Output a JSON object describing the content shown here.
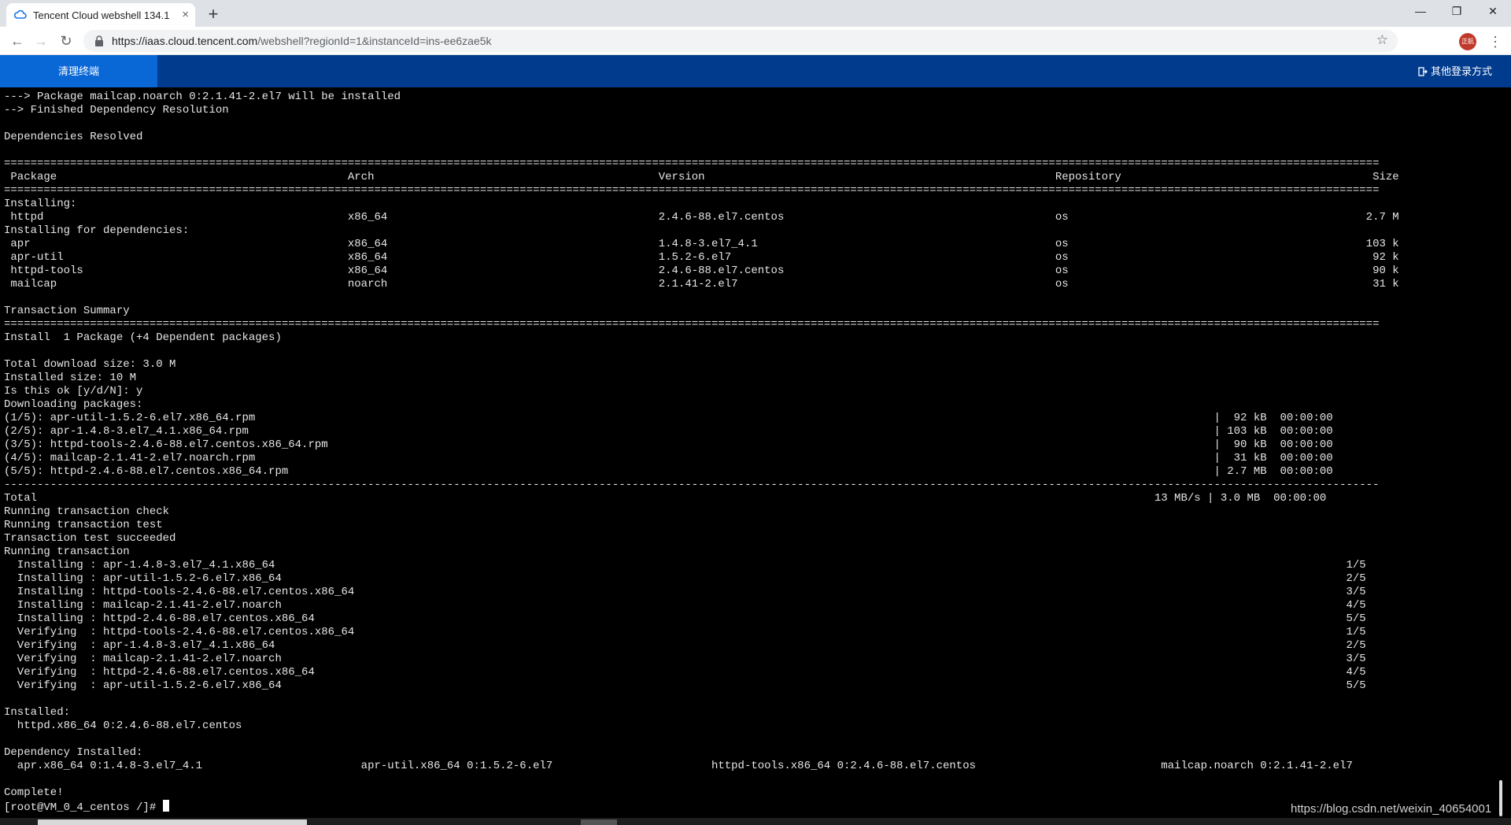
{
  "browser": {
    "tab_title": "Tencent Cloud webshell 134.1",
    "tab_close": "×",
    "new_tab": "+",
    "url_host": "https://iaas.cloud.tencent.com",
    "url_path": "/webshell?regionId=1&instanceId=ins-ee6zae5k",
    "avatar_text": "正航",
    "win_min": "—",
    "win_max": "❐",
    "win_close": "✕"
  },
  "shell": {
    "clear_label": "清理终端",
    "other_login_label": "其他登录方式"
  },
  "terminal": {
    "lines": [
      "---> Package mailcap.noarch 0:2.1.41-2.el7 will be installed",
      "--> Finished Dependency Resolution",
      "",
      "Dependencies Resolved",
      "",
      "================================================================================================================================================================================================================",
      " Package                                            Arch                                           Version                                                     Repository                                      Size",
      "================================================================================================================================================================================================================",
      "Installing:",
      " httpd                                              x86_64                                         2.4.6-88.el7.centos                                         os                                             2.7 M",
      "Installing for dependencies:",
      " apr                                                x86_64                                         1.4.8-3.el7_4.1                                             os                                             103 k",
      " apr-util                                           x86_64                                         1.5.2-6.el7                                                 os                                              92 k",
      " httpd-tools                                        x86_64                                         2.4.6-88.el7.centos                                         os                                              90 k",
      " mailcap                                            noarch                                         2.1.41-2.el7                                                os                                              31 k",
      "",
      "Transaction Summary",
      "================================================================================================================================================================================================================",
      "Install  1 Package (+4 Dependent packages)",
      "",
      "Total download size: 3.0 M",
      "Installed size: 10 M",
      "Is this ok [y/d/N]: y",
      "Downloading packages:",
      "(1/5): apr-util-1.5.2-6.el7.x86_64.rpm                                                                                                                                                 |  92 kB  00:00:00",
      "(2/5): apr-1.4.8-3.el7_4.1.x86_64.rpm                                                                                                                                                  | 103 kB  00:00:00",
      "(3/5): httpd-tools-2.4.6-88.el7.centos.x86_64.rpm                                                                                                                                      |  90 kB  00:00:00",
      "(4/5): mailcap-2.1.41-2.el7.noarch.rpm                                                                                                                                                 |  31 kB  00:00:00",
      "(5/5): httpd-2.4.6-88.el7.centos.x86_64.rpm                                                                                                                                            | 2.7 MB  00:00:00",
      "----------------------------------------------------------------------------------------------------------------------------------------------------------------------------------------------------------------",
      "Total                                                                                                                                                                         13 MB/s | 3.0 MB  00:00:00",
      "Running transaction check",
      "Running transaction test",
      "Transaction test succeeded",
      "Running transaction",
      "  Installing : apr-1.4.8-3.el7_4.1.x86_64                                                                                                                                                                  1/5",
      "  Installing : apr-util-1.5.2-6.el7.x86_64                                                                                                                                                                 2/5",
      "  Installing : httpd-tools-2.4.6-88.el7.centos.x86_64                                                                                                                                                      3/5",
      "  Installing : mailcap-2.1.41-2.el7.noarch                                                                                                                                                                 4/5",
      "  Installing : httpd-2.4.6-88.el7.centos.x86_64                                                                                                                                                            5/5",
      "  Verifying  : httpd-tools-2.4.6-88.el7.centos.x86_64                                                                                                                                                      1/5",
      "  Verifying  : apr-1.4.8-3.el7_4.1.x86_64                                                                                                                                                                  2/5",
      "  Verifying  : mailcap-2.1.41-2.el7.noarch                                                                                                                                                                 3/5",
      "  Verifying  : httpd-2.4.6-88.el7.centos.x86_64                                                                                                                                                            4/5",
      "  Verifying  : apr-util-1.5.2-6.el7.x86_64                                                                                                                                                                 5/5",
      "",
      "Installed:",
      "  httpd.x86_64 0:2.4.6-88.el7.centos",
      "",
      "Dependency Installed:",
      "  apr.x86_64 0:1.4.8-3.el7_4.1                        apr-util.x86_64 0:1.5.2-6.el7                        httpd-tools.x86_64 0:2.4.6-88.el7.centos                            mailcap.noarch 0:2.1.41-2.el7",
      "",
      "Complete!"
    ],
    "prompt": "[root@VM_0_4_centos /]# "
  },
  "watermark": "https://blog.csdn.net/weixin_40654001"
}
